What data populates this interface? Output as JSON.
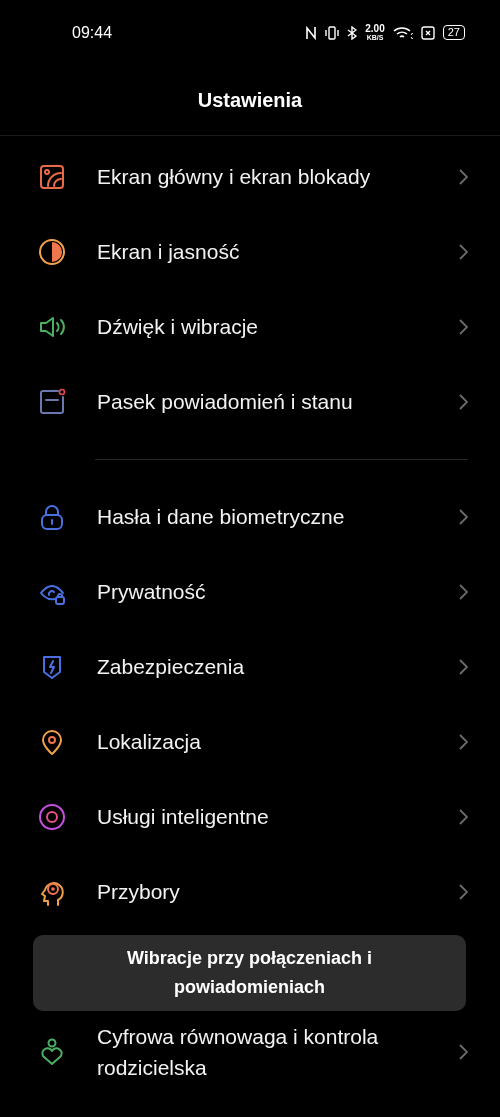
{
  "status_bar": {
    "time": "09:44",
    "speed_value": "2.00",
    "speed_unit": "KB/S",
    "battery": "27"
  },
  "title": "Ustawienia",
  "groups": [
    {
      "items": [
        {
          "kind": "wallpaper",
          "label": "Ekran główny i ekran blokady"
        },
        {
          "kind": "display",
          "label": "Ekran i jasność"
        },
        {
          "kind": "sound",
          "label": "Dźwięk i wibracje"
        },
        {
          "kind": "notification",
          "label": "Pasek powiadomień i stanu"
        }
      ]
    },
    {
      "items": [
        {
          "kind": "lock",
          "label": "Hasła i dane biometryczne"
        },
        {
          "kind": "privacy",
          "label": "Prywatność"
        },
        {
          "kind": "shield",
          "label": "Zabezpieczenia"
        },
        {
          "kind": "location",
          "label": "Lokalizacja"
        },
        {
          "kind": "smart",
          "label": "Usługi inteligentne"
        },
        {
          "kind": "head",
          "label": "Przybory"
        },
        {
          "kind": "hidden"
        },
        {
          "kind": "wellbeing",
          "label": "Cyfrowa równowaga i kontrola rodzicielska"
        }
      ]
    }
  ],
  "toast": {
    "text": "Wibracje przy połączeniach i powiadomieniach"
  }
}
